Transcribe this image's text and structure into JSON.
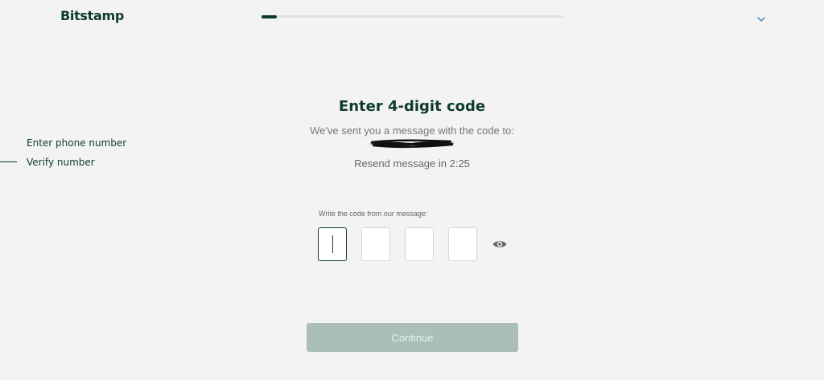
{
  "header": {
    "logo_text": "Bitstamp",
    "progress_fraction": 0.05,
    "menu_icon": "chevron-down-icon"
  },
  "steps": [
    {
      "label": "Enter phone number",
      "current": false
    },
    {
      "label": "Verify number",
      "current": true
    }
  ],
  "main": {
    "title": "Enter 4-digit code",
    "subtitle": "We've sent you a message with the code to:",
    "resend_text": "Resend message in 2:25",
    "code_label": "Write the code from our message:",
    "code_digits": [
      "",
      "",
      "",
      ""
    ],
    "reveal_icon": "eye-icon",
    "continue_label": "Continue"
  },
  "colors": {
    "brand": "#0d3b2e",
    "background": "#f3f3f3",
    "button_disabled": "#a9bfb8",
    "button_text": "#e4f6ef",
    "accent_blue": "#3b82c4"
  }
}
